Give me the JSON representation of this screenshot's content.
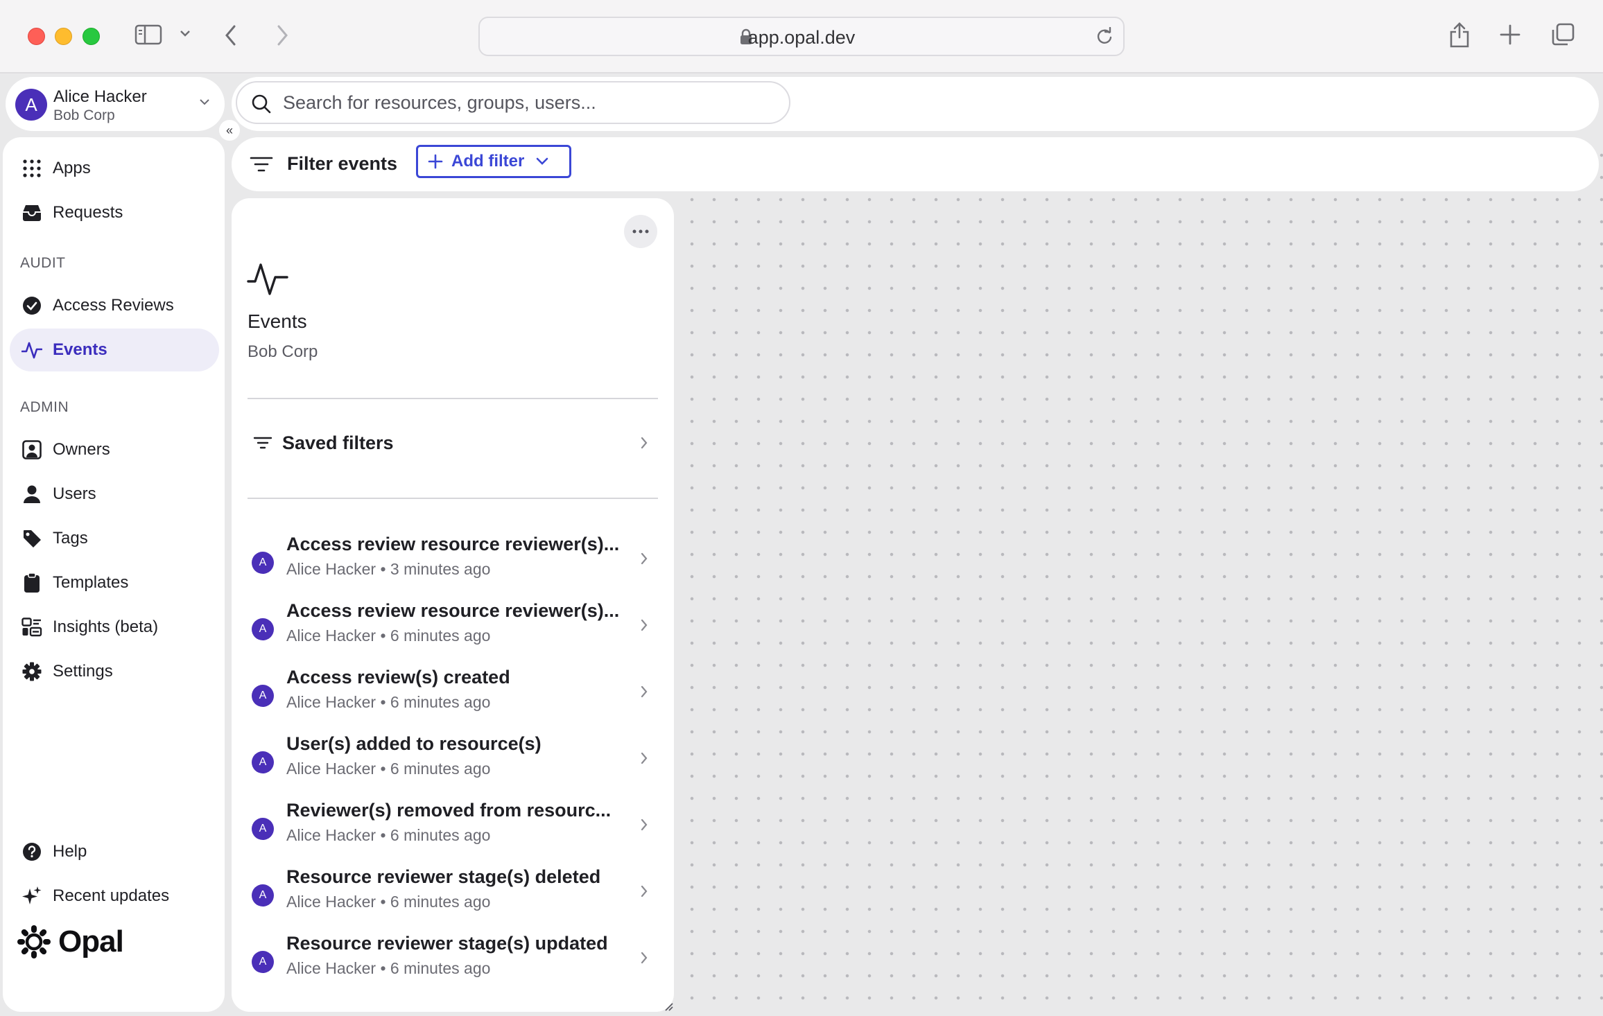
{
  "browser": {
    "url": "app.opal.dev"
  },
  "account": {
    "initial": "A",
    "name": "Alice Hacker",
    "org": "Bob Corp"
  },
  "collapse_glyph": "«",
  "search": {
    "placeholder": "Search for resources, groups, users..."
  },
  "filterbar": {
    "label": "Filter events",
    "add_filter_label": "Add filter"
  },
  "sidebar": {
    "top_items": [
      {
        "label": "Apps",
        "icon": "grid-icon"
      },
      {
        "label": "Requests",
        "icon": "inbox-icon"
      }
    ],
    "audit_label": "AUDIT",
    "audit_items": [
      {
        "label": "Access Reviews",
        "icon": "check-circle-icon"
      },
      {
        "label": "Events",
        "icon": "activity-icon",
        "active": true
      }
    ],
    "admin_label": "ADMIN",
    "admin_items": [
      {
        "label": "Owners",
        "icon": "owner-icon"
      },
      {
        "label": "Users",
        "icon": "user-icon"
      },
      {
        "label": "Tags",
        "icon": "tag-icon"
      },
      {
        "label": "Templates",
        "icon": "clipboard-icon"
      },
      {
        "label": "Insights (beta)",
        "icon": "insights-icon"
      },
      {
        "label": "Settings",
        "icon": "gear-icon"
      }
    ],
    "bottom_items": [
      {
        "label": "Help",
        "icon": "help-icon"
      },
      {
        "label": "Recent updates",
        "icon": "sparkle-icon"
      }
    ],
    "brand": "Opal"
  },
  "panel": {
    "title": "Events",
    "subtitle": "Bob Corp",
    "saved_filters_label": "Saved filters",
    "events": [
      {
        "initial": "A",
        "title": "Access review resource reviewer(s)...",
        "meta": "Alice Hacker • 3 minutes ago"
      },
      {
        "initial": "A",
        "title": "Access review resource reviewer(s)...",
        "meta": "Alice Hacker • 6 minutes ago"
      },
      {
        "initial": "A",
        "title": "Access review(s) created",
        "meta": "Alice Hacker • 6 minutes ago"
      },
      {
        "initial": "A",
        "title": "User(s) added to resource(s)",
        "meta": "Alice Hacker • 6 minutes ago"
      },
      {
        "initial": "A",
        "title": "Reviewer(s) removed from resourc...",
        "meta": "Alice Hacker • 6 minutes ago"
      },
      {
        "initial": "A",
        "title": "Resource reviewer stage(s) deleted",
        "meta": "Alice Hacker • 6 minutes ago"
      },
      {
        "initial": "A",
        "title": "Resource reviewer stage(s) updated",
        "meta": "Alice Hacker • 6 minutes ago"
      }
    ]
  },
  "colors": {
    "accent": "#3b47d6",
    "avatar": "#4a2fb8",
    "active_nav_bg": "#eeedf8"
  }
}
